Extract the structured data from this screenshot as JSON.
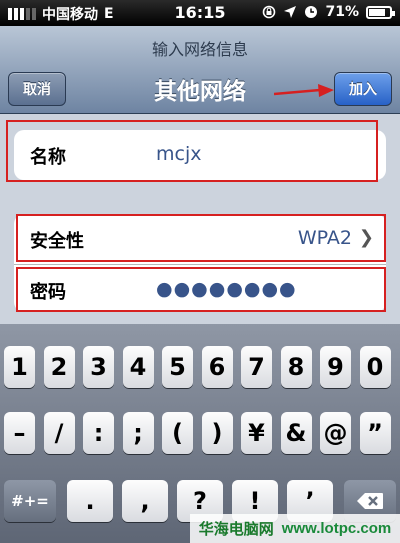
{
  "status_bar": {
    "carrier": "中国移动",
    "network": "E",
    "time": "16:15",
    "battery": "71%"
  },
  "nav": {
    "prompt": "输入网络信息",
    "title": "其他网络",
    "cancel_label": "取消",
    "join_label": "加入"
  },
  "form": {
    "name_label": "名称",
    "name_value": "mcjx",
    "security_label": "安全性",
    "security_value": "WPA2",
    "password_label": "密码",
    "password_value": "●●●●●●●●"
  },
  "keyboard": {
    "row1": [
      "1",
      "2",
      "3",
      "4",
      "5",
      "6",
      "7",
      "8",
      "9",
      "0"
    ],
    "row2": [
      "–",
      "/",
      ":",
      ";",
      "(",
      ")",
      "¥",
      "&",
      "@",
      "”"
    ],
    "row3_mode": "#+=",
    "row3": [
      ".",
      ",",
      "?",
      "!",
      "’"
    ]
  },
  "watermark": {
    "brand": "华海电脑网",
    "url": "www.lotpc.com"
  },
  "colors": {
    "join_button": "#2761c7",
    "annotation_red": "#d62020"
  }
}
